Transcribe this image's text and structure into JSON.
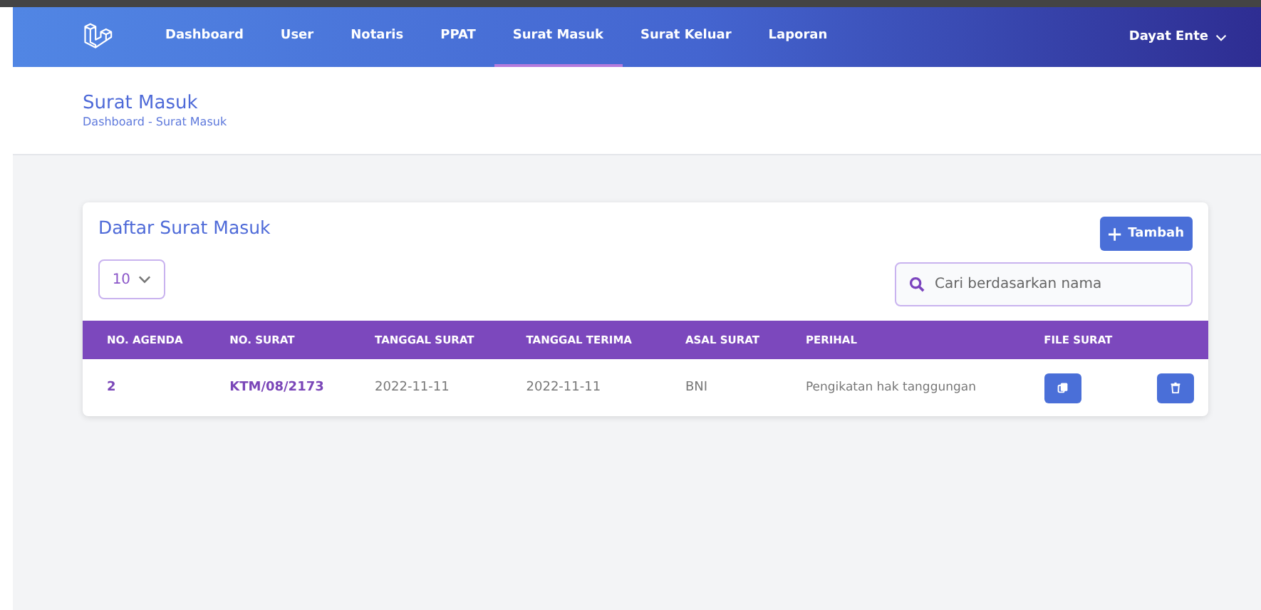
{
  "navbar": {
    "items": [
      {
        "label": "Dashboard",
        "selected": false
      },
      {
        "label": "User",
        "selected": false
      },
      {
        "label": "Notaris",
        "selected": false
      },
      {
        "label": "PPAT",
        "selected": false
      },
      {
        "label": "Surat Masuk",
        "selected": true
      },
      {
        "label": "Surat Keluar",
        "selected": false
      },
      {
        "label": "Laporan",
        "selected": false
      }
    ],
    "user": "Dayat Ente"
  },
  "header": {
    "title": "Surat Masuk",
    "breadcrumb": "Dashboard - Surat Masuk"
  },
  "card": {
    "title": "Daftar Surat Masuk",
    "add_button": "Tambah",
    "page_size": "10",
    "search": {
      "placeholder": "Cari berdasarkan nama"
    }
  },
  "table": {
    "columns": [
      "NO. AGENDA",
      "NO. SURAT",
      "TANGGAL SURAT",
      "TANGGAL TERIMA",
      "ASAL SURAT",
      "PERIHAL",
      "FILE SURAT"
    ],
    "rows": [
      {
        "cells": [
          "2",
          "KTM/08/2173",
          "2022-11-11",
          "2022-11-11",
          "BNI",
          "Pengikatan hak tanggungan"
        ]
      }
    ]
  }
}
